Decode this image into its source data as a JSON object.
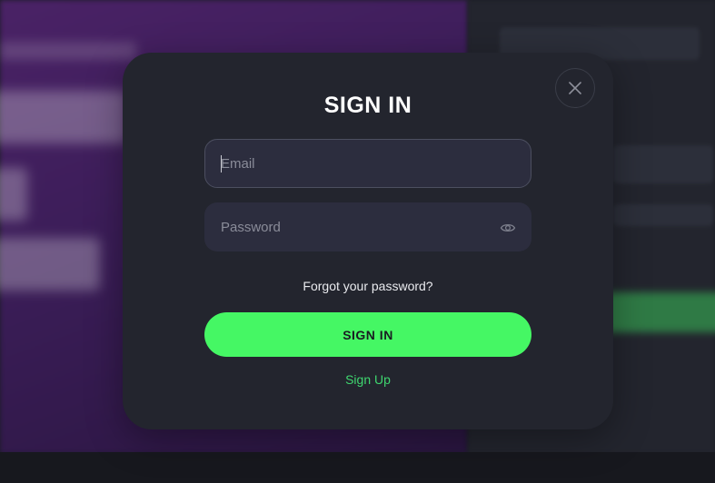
{
  "modal": {
    "title": "SIGN IN",
    "close_icon": "close-icon",
    "email": {
      "placeholder": "Email",
      "value": ""
    },
    "password": {
      "placeholder": "Password",
      "value": "",
      "toggle_icon": "eye-icon"
    },
    "forgot_password_label": "Forgot your password?",
    "submit_label": "SIGN IN",
    "signup_label": "Sign Up"
  },
  "colors": {
    "modal_bg": "#23252e",
    "input_bg": "#2c2d3e",
    "primary_button": "#45f764",
    "link_accent": "#3fd66f",
    "background_hero": "#4a2266"
  }
}
